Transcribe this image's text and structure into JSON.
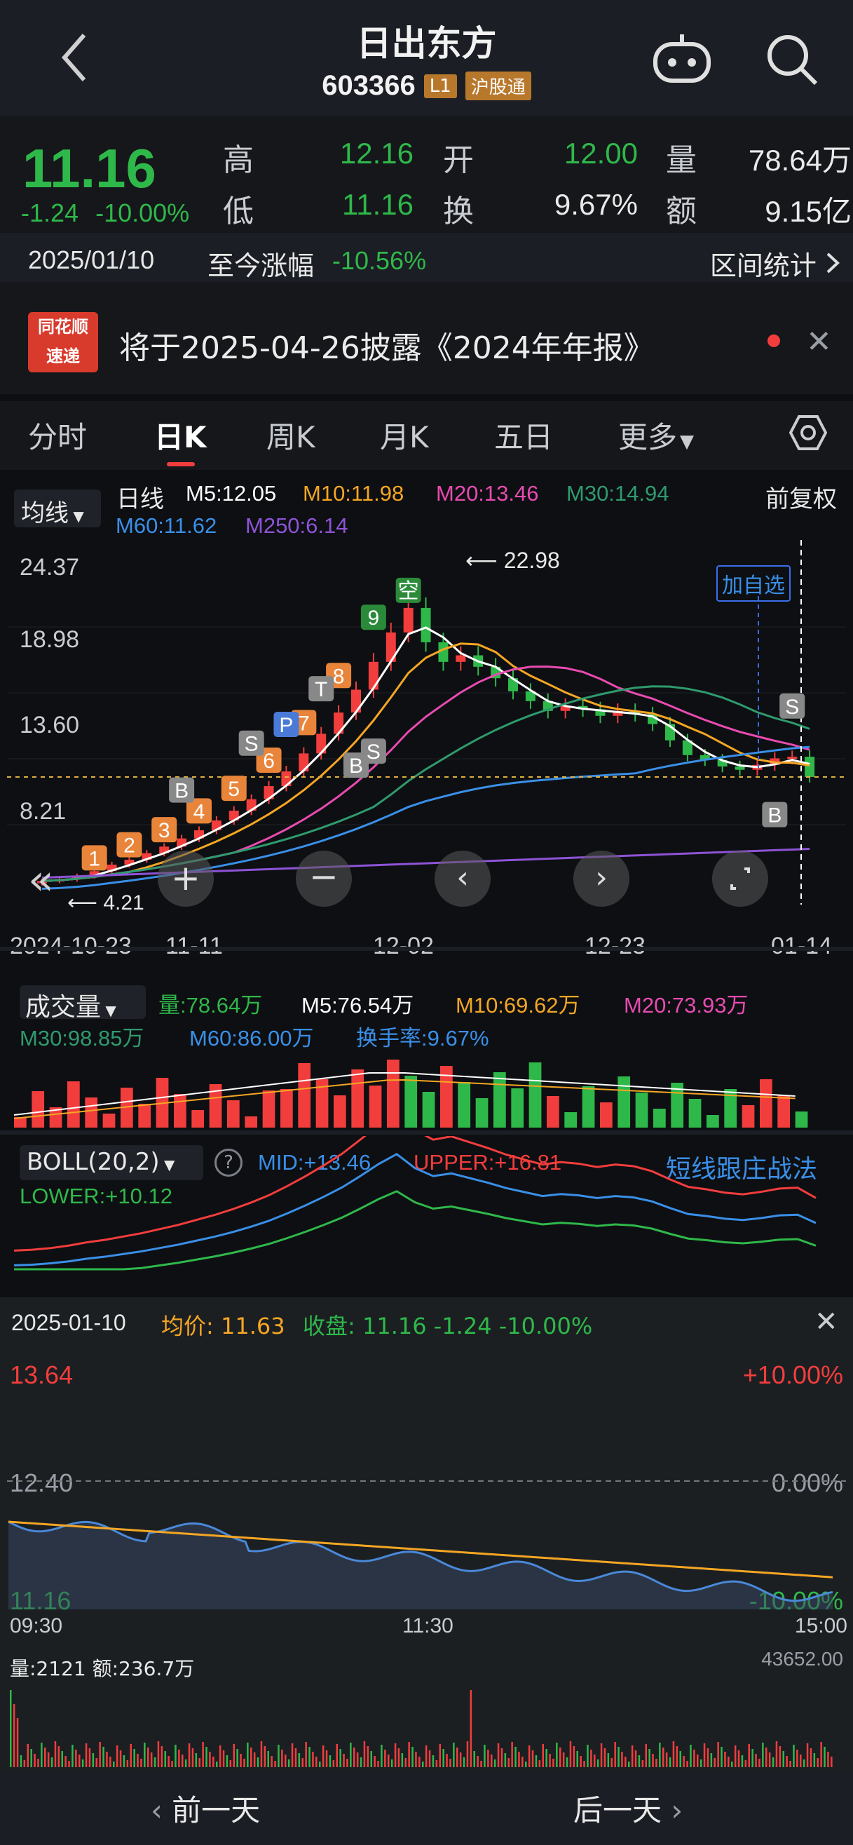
{
  "header": {
    "title": "日出东方",
    "code": "603366",
    "tag_level": "L1",
    "tag_market": "沪股通"
  },
  "quote": {
    "price": "11.16",
    "change": "-1.24",
    "change_pct": "-10.00%",
    "high_label": "高",
    "high": "12.16",
    "open_label": "开",
    "open": "12.00",
    "volume_label": "量",
    "volume": "78.64万",
    "low_label": "低",
    "low": "11.16",
    "turnover_label": "换",
    "turnover": "9.67%",
    "amount_label": "额",
    "amount": "9.15亿",
    "date": "2025/01/10",
    "since_label": "至今涨幅",
    "since_value": "-10.56%",
    "range_stats": "区间统计"
  },
  "notice": {
    "logo_line1": "同花顺",
    "logo_line2": "速递",
    "text": "将于2025-04-26披露《2024年年报》"
  },
  "tabs": [
    "分时",
    "日K",
    "周K",
    "月K",
    "五日",
    "更多"
  ],
  "kline": {
    "indicator_select": "均线",
    "line_type": "日线",
    "ma": {
      "m5": "M5:12.05",
      "m10": "M10:11.98",
      "m20": "M20:13.46",
      "m30": "M30:14.94",
      "m60": "M60:11.62",
      "m250": "M250:6.14"
    },
    "adjust": "前复权",
    "y_ticks": [
      "24.37",
      "18.98",
      "13.60",
      "8.21"
    ],
    "x_ticks": [
      "2024-10-23",
      "11-11",
      "12-02",
      "12-23",
      "01-14"
    ],
    "max_label": "22.98",
    "min_label": "4.21",
    "watch_add": "加自选",
    "signals": {
      "b": "B",
      "s": "S",
      "t": "T",
      "p": "P",
      "kong": "空"
    },
    "nine_count": [
      "1",
      "2",
      "3",
      "4",
      "5",
      "6",
      "7",
      "8",
      "9"
    ],
    "colors": {
      "m5": "#ffffff",
      "m10": "#f5a623",
      "m20": "#e84bb0",
      "m30": "#2f9a6e",
      "m60": "#3a8fe8",
      "m250": "#8e53d6",
      "up": "#f23d3d",
      "down": "#2fb84a"
    }
  },
  "chart_data": {
    "type": "candlestick",
    "ylim": [
      4.21,
      24.37
    ],
    "closes": [
      4.8,
      4.9,
      5.1,
      5.4,
      5.8,
      6.1,
      6.5,
      6.9,
      7.4,
      7.9,
      8.5,
      9.1,
      9.8,
      10.6,
      11.5,
      12.6,
      13.8,
      15.1,
      16.5,
      18.2,
      20.0,
      21.5,
      19.4,
      18.2,
      18.6,
      17.9,
      17.2,
      16.4,
      15.8,
      15.2,
      15.5,
      15.3,
      14.9,
      15.2,
      15.0,
      14.4,
      13.4,
      12.5,
      12.2,
      11.8,
      11.6,
      11.9,
      12.3,
      12.4,
      11.16
    ]
  },
  "volume": {
    "title": "成交量",
    "vol": "量:78.64万",
    "m5": "M5:76.54万",
    "m10": "M10:69.62万",
    "m20": "M20:73.93万",
    "m30": "M30:98.85万",
    "m60": "M60:86.00万",
    "turnover": "换手率:9.67%"
  },
  "boll": {
    "title": "BOLL(20,2)",
    "mid": "MID:+13.46",
    "upper": "UPPER:+16.81",
    "lower": "LOWER:+10.12",
    "strategy": "短线跟庄战法"
  },
  "intraday": {
    "date": "2025-01-10",
    "avg_label": "均价:",
    "avg": "11.63",
    "close_label": "收盘:",
    "close": "11.16 -1.24 -10.00%",
    "top_price": "13.64",
    "mid_price": "12.40",
    "bottom_price": "11.16",
    "top_pct": "+10.00%",
    "mid_pct": "0.00%",
    "bottom_pct": "-10.00%",
    "times": [
      "09:30",
      "11:30",
      "15:00"
    ],
    "vol_label": "量:2121",
    "amt_label": "额:236.7万",
    "vol_max": "43652.00"
  },
  "nav": {
    "prev": "前一天",
    "next": "后一天"
  }
}
